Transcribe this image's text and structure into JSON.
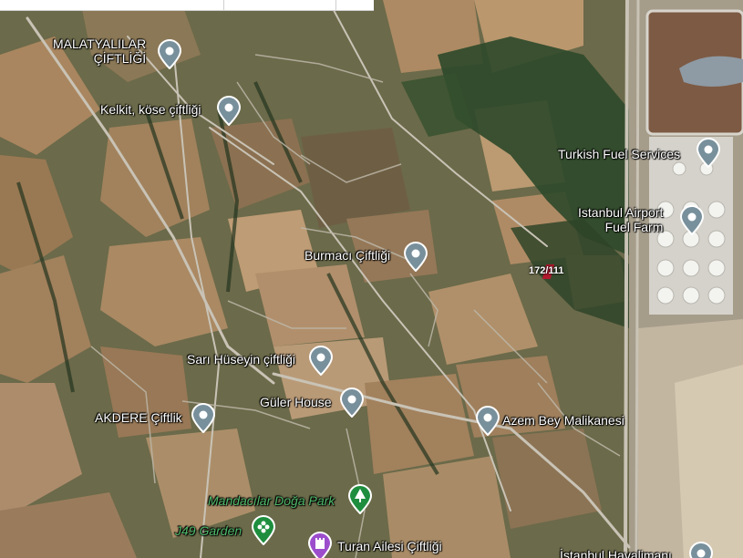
{
  "colors": {
    "pin_fill": "#78909c",
    "pin_green": "#1e8e3e",
    "pin_purple": "#9c4dcc",
    "label_text": "#ffffff",
    "label_green": "#4fb86a",
    "plot_mark": "#c8102e"
  },
  "places": [
    {
      "id": "malatyalilar",
      "lines": [
        "MALATYALILAR",
        "ÇİFTLİĞİ"
      ],
      "icon": "map-pin-icon"
    },
    {
      "id": "kelkit",
      "lines": [
        "Kelkit, köse çiftliği"
      ],
      "icon": "map-pin-icon"
    },
    {
      "id": "turkish_fuel",
      "lines": [
        "Turkish Fuel Services"
      ],
      "icon": "map-pin-icon"
    },
    {
      "id": "istanbul_airport_fuel",
      "lines": [
        "Istanbul Airport",
        "Fuel Farm"
      ],
      "icon": "map-pin-icon"
    },
    {
      "id": "burmaci",
      "lines": [
        "Burmacı Çiftliği"
      ],
      "icon": "map-pin-icon"
    },
    {
      "id": "sari_huseyin",
      "lines": [
        "Sarı Hüseyin çiftliği"
      ],
      "icon": "map-pin-icon"
    },
    {
      "id": "guler_house",
      "lines": [
        "Güler House"
      ],
      "icon": "map-pin-icon"
    },
    {
      "id": "akdere",
      "lines": [
        "AKDERE Çiftlik"
      ],
      "icon": "map-pin-icon"
    },
    {
      "id": "azem_bey",
      "lines": [
        "Azem Bey Malikanesi"
      ],
      "icon": "map-pin-icon"
    },
    {
      "id": "mandacilar",
      "lines": [
        "Mandacılar Doğa Park"
      ],
      "icon": "tree-icon"
    },
    {
      "id": "j49_garden",
      "lines": [
        "J49 Garden"
      ],
      "icon": "flower-icon"
    },
    {
      "id": "turan_ailesi",
      "lines": [
        "Turan Ailesi Çiftliği"
      ],
      "icon": "castle-icon"
    },
    {
      "id": "istanbul_havalimani",
      "lines": [
        "İstanbul Havalimanı"
      ],
      "icon": "map-pin-icon"
    }
  ],
  "parcel_label": "172/111"
}
